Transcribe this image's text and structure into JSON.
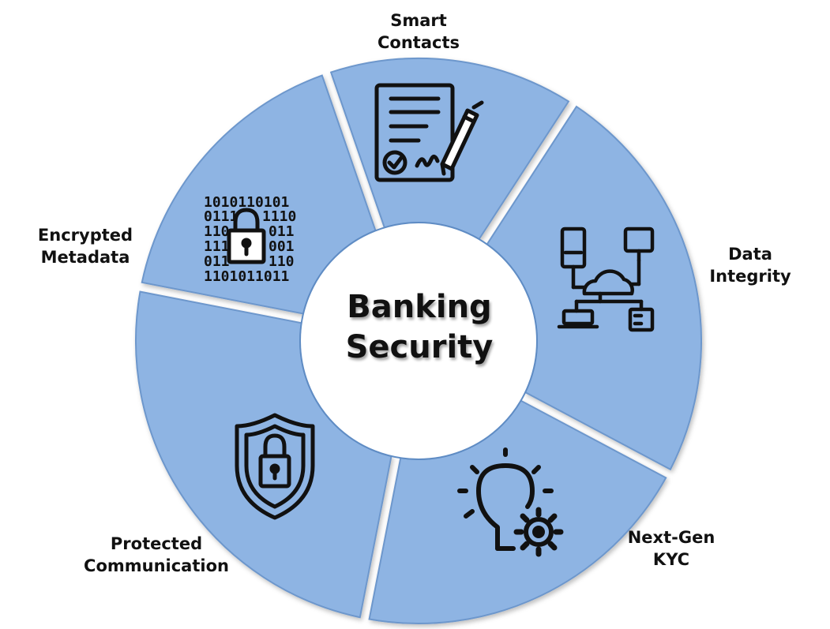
{
  "center": {
    "line1": "Banking",
    "line2": "Security"
  },
  "segments": [
    {
      "id": "smart-contacts",
      "line1": "Smart",
      "line2": "Contacts",
      "icon": "contract-pen-icon"
    },
    {
      "id": "data-integrity",
      "line1": "Data",
      "line2": "Integrity",
      "icon": "cloud-network-icon"
    },
    {
      "id": "next-gen-kyc",
      "line1": "Next-Gen",
      "line2": "KYC",
      "icon": "lightbulb-gear-icon"
    },
    {
      "id": "protected-communication",
      "line1": "Protected",
      "line2": "Communication",
      "icon": "shield-lock-icon"
    },
    {
      "id": "encrypted-metadata",
      "line1": "Encrypted",
      "line2": "Metadata",
      "icon": "binary-lock-icon"
    }
  ],
  "colors": {
    "segment_fill": "#8eb4e3",
    "segment_stroke": "#6d97cc",
    "hub_fill": "#ffffff",
    "icon": "#111111",
    "text": "#111111"
  }
}
